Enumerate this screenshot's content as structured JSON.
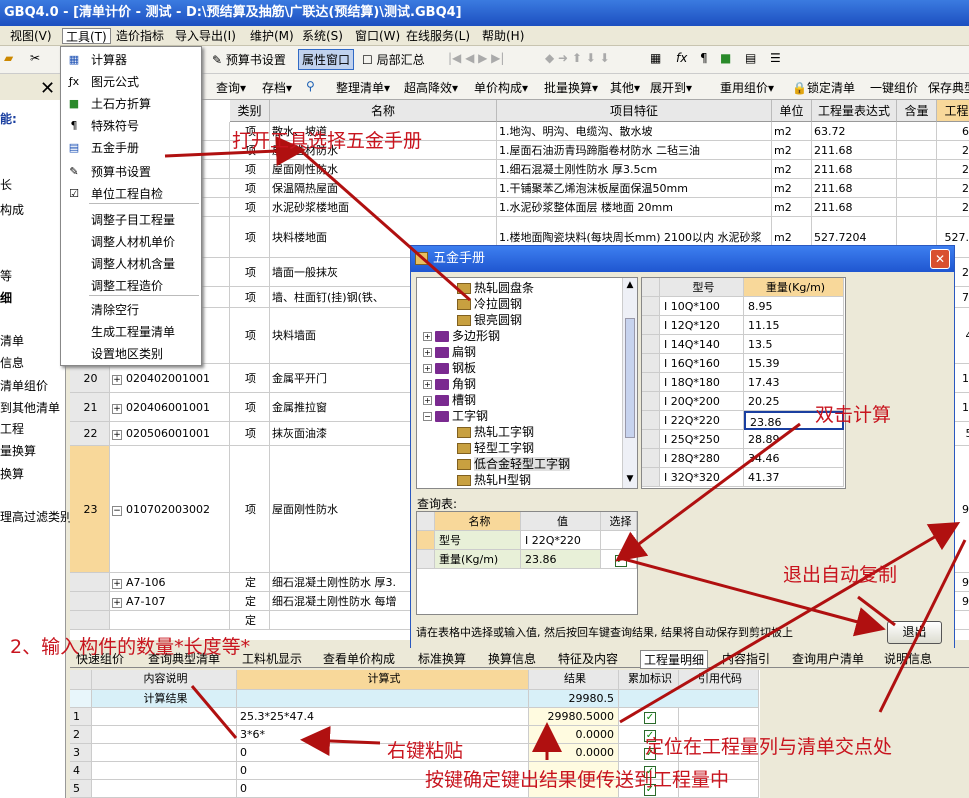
{
  "window": {
    "title": "GBQ4.0 - [清单计价 - 测试 - D:\\预结算及抽筋\\广联达(预结算)\\测试.GBQ4]"
  },
  "menu": [
    "视图(V)",
    "工具(T)",
    "造价指标",
    "导入导出(I)",
    "维护(M)",
    "系统(S)",
    "窗口(W)",
    "在线服务(L)",
    "帮助(H)"
  ],
  "toolbar1": {
    "budget_settings": "预算书设置",
    "property_window": "属性窗口",
    "local_summary": "局部汇总"
  },
  "toolbar2": [
    "查询",
    "存档",
    "整理清单",
    "超高降效",
    "单价构成",
    "批量换算",
    "其他",
    "展开到",
    "重用组价",
    "锁定清单",
    "一键组价",
    "保存典型"
  ],
  "left_panel": [
    "能:",
    "长",
    "构成",
    "等",
    "细",
    "清单",
    "信息",
    "清单组价",
    "到其他清单",
    "工程",
    "量换算",
    "换算",
    "理高过滤类别"
  ],
  "dropdown": {
    "items": [
      {
        "label": "计算器",
        "icon": "calculator-icon"
      },
      {
        "label": "图元公式",
        "icon": "formula-icon"
      },
      {
        "label": "土石方折算",
        "icon": "cube-icon"
      },
      {
        "label": "特殊符号",
        "icon": "pilcrow-icon"
      },
      {
        "label": "五金手册",
        "icon": "handbook-icon"
      },
      {
        "label": "预算书设置",
        "icon": "settings-icon"
      },
      {
        "label": "单位工程自检",
        "icon": "check-icon"
      },
      {
        "label": "调整子目工程量",
        "icon": ""
      },
      {
        "label": "调整人材机单价",
        "icon": ""
      },
      {
        "label": "调整人材机含量",
        "icon": ""
      },
      {
        "label": "调整工程造价",
        "icon": ""
      },
      {
        "label": "清除空行",
        "icon": ""
      },
      {
        "label": "生成工程量清单",
        "icon": ""
      },
      {
        "label": "设置地区类别",
        "icon": ""
      }
    ]
  },
  "grid": {
    "headers": [
      "类别",
      "名称",
      "项目特征",
      "单位",
      "工程量表达式",
      "含量",
      "工程"
    ],
    "rows": [
      {
        "num": "",
        "code": "1",
        "type": "项",
        "name": "散水、坡道",
        "feature": "1.地沟、明沟、电缆沟、散水坡",
        "unit": "m2",
        "expr": "63.72",
        "qty": "63"
      },
      {
        "num": "",
        "code": "1",
        "type": "项",
        "name": "屋面卷材防水",
        "feature": "1.屋面石油沥青玛蹄脂卷材防水 二毡三油",
        "unit": "m2",
        "expr": "211.68",
        "qty": "21"
      },
      {
        "num": "",
        "code": "1",
        "type": "项",
        "name": "屋面刚性防水",
        "feature": "1.细石混凝土刚性防水 厚3.5cm",
        "unit": "m2",
        "expr": "211.68",
        "qty": "21"
      },
      {
        "num": "",
        "code": "1",
        "type": "项",
        "name": "保温隔热屋面",
        "feature": "1.干铺聚苯乙烯泡沫板屋面保温50mm",
        "unit": "m2",
        "expr": "211.68",
        "qty": "21"
      },
      {
        "num": "",
        "code": "1",
        "type": "项",
        "name": "水泥砂浆楼地面",
        "feature": "1.水泥砂浆整体面层 楼地面 20mm",
        "unit": "m2",
        "expr": "211.68",
        "qty": "21"
      },
      {
        "num": "",
        "code": "1",
        "type": "项",
        "name": "块料楼地面",
        "feature": "1.楼地面陶瓷块料(每块周长mm) 2100以内 水泥砂浆",
        "unit": "m2",
        "expr": "527.7204",
        "qty": "527.7"
      },
      {
        "num": "",
        "code": "1",
        "type": "项",
        "name": "墙面一般抹灰",
        "feature": "",
        "unit": "",
        "expr": "",
        "qty": "22"
      },
      {
        "num": "",
        "code": "001",
        "type": "项",
        "name": "墙、柱面钉(挂)钢(铁、",
        "feature": "",
        "unit": "",
        "expr": "",
        "qty": "78"
      },
      {
        "num": "",
        "code": "1",
        "type": "项",
        "name": "块料墙面",
        "feature": "",
        "unit": "",
        "expr": "",
        "qty": "4."
      },
      {
        "num": "20",
        "code": "020402001001",
        "type": "项",
        "name": "金属平开门",
        "feature": "",
        "unit": "",
        "expr": "",
        "qty": "16"
      },
      {
        "num": "21",
        "code": "020406001001",
        "type": "项",
        "name": "金属推拉窗",
        "feature": "",
        "unit": "",
        "expr": "",
        "qty": "10"
      },
      {
        "num": "22",
        "code": "020506001001",
        "type": "项",
        "name": "抹灰面油漆",
        "feature": "",
        "unit": "",
        "expr": "",
        "qty": "5."
      },
      {
        "num": "23",
        "code": "010702003002",
        "type": "项",
        "name": "屋面刚性防水",
        "feature": "",
        "unit": "",
        "expr": "",
        "qty": "99"
      },
      {
        "num": "",
        "code": "A7-106",
        "type": "定",
        "name": "细石混凝土刚性防水 厚3.",
        "feature": "",
        "unit": "",
        "expr": "",
        "qty": "99"
      },
      {
        "num": "",
        "code": "A7-107",
        "type": "定",
        "name": "细石混凝土刚性防水 每增",
        "feature": "",
        "unit": "",
        "expr": "",
        "qty": "99"
      },
      {
        "num": "",
        "code": "",
        "type": "定",
        "name": "",
        "feature": "",
        "unit": "",
        "expr": "",
        "qty": ""
      }
    ]
  },
  "dialog": {
    "title": "五金手册",
    "tree": [
      {
        "label": "热轧圆盘条",
        "kind": "doc",
        "indent": 2
      },
      {
        "label": "冷拉圆钢",
        "kind": "doc",
        "indent": 2
      },
      {
        "label": "银亮圆钢",
        "kind": "doc",
        "indent": 2
      },
      {
        "label": "多边形钢",
        "kind": "book",
        "indent": 0
      },
      {
        "label": "扁钢",
        "kind": "book",
        "indent": 0
      },
      {
        "label": "钢板",
        "kind": "book",
        "indent": 0
      },
      {
        "label": "角钢",
        "kind": "book",
        "indent": 0
      },
      {
        "label": "槽钢",
        "kind": "book",
        "indent": 0
      },
      {
        "label": "工字钢",
        "kind": "book-open",
        "indent": 0
      },
      {
        "label": "热轧工字钢",
        "kind": "doc",
        "indent": 2
      },
      {
        "label": "轻型工字钢",
        "kind": "doc",
        "indent": 2
      },
      {
        "label": "低合金轻型工字钢",
        "kind": "doc-sel",
        "indent": 2
      },
      {
        "label": "热轧H型钢",
        "kind": "doc",
        "indent": 2
      }
    ],
    "table_headers": [
      "型号",
      "重量(Kg/m)"
    ],
    "table_rows": [
      [
        "I 10Q*100",
        "8.95"
      ],
      [
        "I 12Q*120",
        "11.15"
      ],
      [
        "I 14Q*140",
        "13.5"
      ],
      [
        "I 16Q*160",
        "15.39"
      ],
      [
        "I 18Q*180",
        "17.43"
      ],
      [
        "I 20Q*200",
        "20.25"
      ],
      [
        "I 22Q*220",
        "23.86"
      ],
      [
        "I 25Q*250",
        "28.89"
      ],
      [
        "I 28Q*280",
        "34.46"
      ],
      [
        "I 32Q*320",
        "41.37"
      ]
    ],
    "query_label": "查询表:",
    "query_headers": [
      "名称",
      "值",
      "选择"
    ],
    "query_rows": [
      [
        "型号",
        "I 22Q*220"
      ],
      [
        "重量(Kg/m)",
        "23.86"
      ]
    ],
    "status": "请在表格中选择或输入值, 然后按回车键查询结果, 结果将自动保存到剪切板上",
    "exit_button": "退出"
  },
  "bottom_tabs": [
    "快速组价",
    "查询典型清单",
    "工料机显示",
    "查看单价构成",
    "标准换算",
    "换算信息",
    "特征及内容",
    "工程量明细",
    "内容指引",
    "查询用户清单",
    "说明信息"
  ],
  "calc": {
    "headers": [
      "内容说明",
      "计算式",
      "结果",
      "累加标识",
      "引用代码"
    ],
    "summary_label": "计算结果",
    "summary_value": "29980.5",
    "rows": [
      {
        "n": "1",
        "expr": "25.3*25*47.4",
        "result": "29980.5000",
        "checked": true
      },
      {
        "n": "2",
        "expr": "3*6*",
        "result": "0.0000",
        "checked": true
      },
      {
        "n": "3",
        "expr": "0",
        "result": "0.0000",
        "checked": true
      },
      {
        "n": "4",
        "expr": "0",
        "result": "",
        "checked": true
      },
      {
        "n": "5",
        "expr": "0",
        "result": "",
        "checked": true
      }
    ]
  },
  "annotations": {
    "open_tools": "打开工具选择五金手册",
    "double_click": "双击计算",
    "exit_copy": "退出自动复制",
    "input_count": "2、输入构件的数量*长度等*",
    "right_paste": "右键粘贴",
    "locate": "定位在工程量列与清单交点处",
    "enter_send": "按键确定键出结果便传送到工程量中"
  }
}
